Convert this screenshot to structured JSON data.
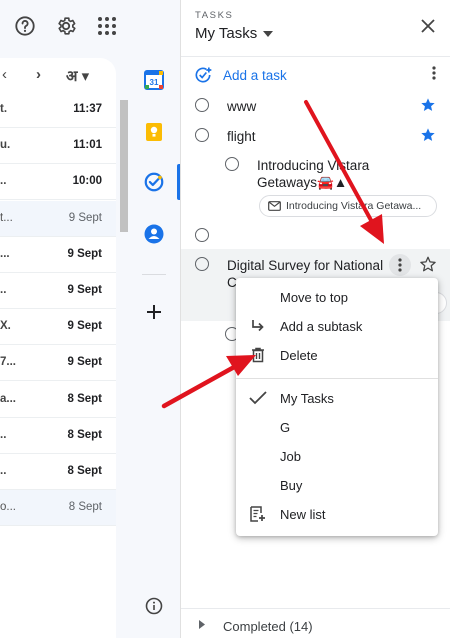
{
  "gmail": {
    "pager": {
      "prev": "‹",
      "next": "›",
      "lang": "अ"
    },
    "rows": [
      {
        "snippet": "t.",
        "time": "11:37",
        "read": false
      },
      {
        "snippet": "u.",
        "time": "11:01",
        "read": false
      },
      {
        "snippet": "..",
        "time": "10:00",
        "read": false
      },
      {
        "snippet": "t...",
        "time": "9 Sept",
        "read": true
      },
      {
        "snippet": "...",
        "time": "9 Sept",
        "read": false
      },
      {
        "snippet": "..",
        "time": "9 Sept",
        "read": false
      },
      {
        "snippet": "X.",
        "time": "9 Sept",
        "read": false
      },
      {
        "snippet": "7...",
        "time": "9 Sept",
        "read": false
      },
      {
        "snippet": "a...",
        "time": "8 Sept",
        "read": false
      },
      {
        "snippet": "..",
        "time": "8 Sept",
        "read": false
      },
      {
        "snippet": "..",
        "time": "8 Sept",
        "read": false
      },
      {
        "snippet": "o...",
        "time": "8 Sept",
        "read": true
      }
    ]
  },
  "rail": {
    "calendar_day": "31"
  },
  "tasks": {
    "label": "TASKS",
    "title": "My Tasks",
    "add_task": "Add a task",
    "items": [
      {
        "text": "www"
      },
      {
        "text": "flight"
      },
      {
        "text": "Introducing Vistara Getaways🚘▲"
      },
      {
        "text": ""
      },
      {
        "text": "Digital Survey for National C"
      }
    ],
    "chip_text": "Introducing Vistara Getawa...",
    "chip2_text": "...",
    "completed": "Completed (14)"
  },
  "menu": {
    "items": [
      {
        "label": "Move to top",
        "icon": ""
      },
      {
        "label": "Add a subtask",
        "icon": "subtask-icon"
      },
      {
        "label": "Delete",
        "icon": "trash-icon"
      },
      {
        "label": "My Tasks",
        "icon": "check-icon"
      },
      {
        "label": "G",
        "icon": ""
      },
      {
        "label": "Job",
        "icon": ""
      },
      {
        "label": "Buy",
        "icon": ""
      },
      {
        "label": "New list",
        "icon": "new-list-icon"
      }
    ]
  },
  "colors": {
    "accent": "#1a73e8",
    "arrow": "#e0141e",
    "panel_bg": "#f6f8fc"
  }
}
